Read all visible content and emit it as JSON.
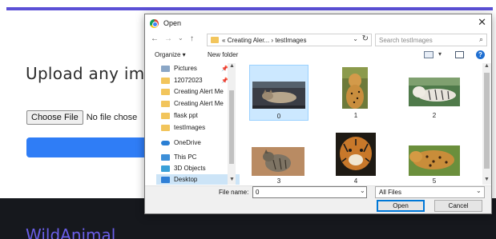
{
  "page": {
    "heading": "Upload any ima",
    "choose_file_label": "Choose File",
    "no_file_text": "No file chose",
    "brand": "WildAnimal"
  },
  "dialog": {
    "title": "Open",
    "close_glyph": "✕",
    "nav": {
      "back": "←",
      "forward": "→",
      "recent": "⌄",
      "up": "↑"
    },
    "address": {
      "prefix": "«",
      "path_parent": "Creating Aler...",
      "separator": "›",
      "path_current": "testImages",
      "dropdown": "⌄",
      "refresh": "↻"
    },
    "search": {
      "placeholder": "Search testImages",
      "icon": "⌕"
    },
    "toolbar": {
      "organize": "Organize ▾",
      "new_folder": "New folder",
      "view_dd": "▾",
      "help": "?"
    },
    "nav_items": [
      {
        "label": "Pictures",
        "icon": "pictures-icon",
        "pinned": true,
        "selected": false
      },
      {
        "label": "12072023",
        "icon": "folder-icon",
        "pinned": true,
        "selected": false
      },
      {
        "label": "Creating Alert Me",
        "icon": "folder-icon",
        "pinned": false,
        "selected": false
      },
      {
        "label": "Creating Alert Me",
        "icon": "folder-icon",
        "pinned": false,
        "selected": false
      },
      {
        "label": "flask ppt",
        "icon": "folder-icon",
        "pinned": false,
        "selected": false
      },
      {
        "label": "testImages",
        "icon": "folder-icon",
        "pinned": false,
        "selected": false
      },
      {
        "label": "OneDrive",
        "icon": "cloud-icon",
        "pinned": false,
        "selected": false
      },
      {
        "label": "This PC",
        "icon": "computer-icon",
        "pinned": false,
        "selected": false
      },
      {
        "label": "3D Objects",
        "icon": "3d-objects-icon",
        "pinned": false,
        "selected": false
      },
      {
        "label": "Desktop",
        "icon": "desktop-icon",
        "pinned": false,
        "selected": true
      }
    ],
    "pin_glyph": "📌",
    "files": [
      {
        "label": "0",
        "subject": "sleeping-cat",
        "selected": true
      },
      {
        "label": "1",
        "subject": "cheetah",
        "selected": false
      },
      {
        "label": "2",
        "subject": "white-tiger",
        "selected": false
      },
      {
        "label": "3",
        "subject": "tabby-cat",
        "selected": false
      },
      {
        "label": "4",
        "subject": "tiger",
        "selected": false
      },
      {
        "label": "5",
        "subject": "leopard",
        "selected": false
      }
    ],
    "file_name_label": "File name:",
    "file_name_value": "0",
    "file_type_value": "All Files",
    "open_button": "Open",
    "cancel_button": "Cancel"
  },
  "colors": {
    "accent_bar": "#5b50d6",
    "upload_button": "#2f7df6",
    "footer": "#16181d",
    "brand_text": "#6a5ee8",
    "selection": "#cce8ff"
  }
}
